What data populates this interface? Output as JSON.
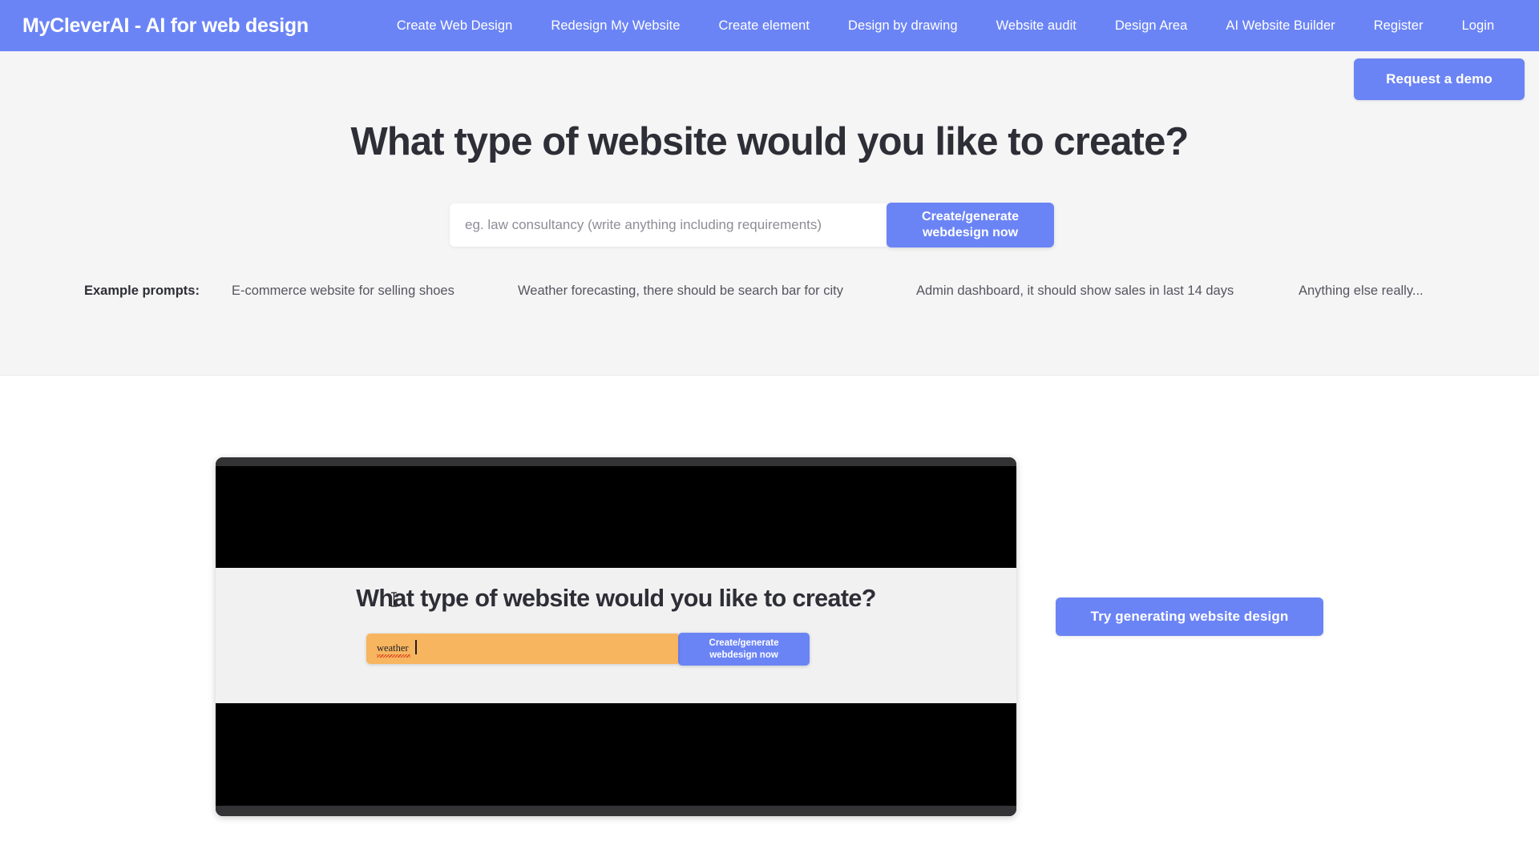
{
  "navbar": {
    "logo": "MyCleverAI - AI for web design",
    "links": [
      {
        "label": "Create Web Design"
      },
      {
        "label": "Redesign My Website"
      },
      {
        "label": "Create element"
      },
      {
        "label": "Design by drawing"
      },
      {
        "label": "Website audit"
      },
      {
        "label": "Design Area"
      },
      {
        "label": "AI Website Builder"
      },
      {
        "label": "Register"
      },
      {
        "label": "Login"
      }
    ],
    "background_color": "#6b84f5",
    "text_color": "#ffffff"
  },
  "hero": {
    "demo_button": "Request a demo",
    "title": "What type of website would you like to create?",
    "search": {
      "placeholder": "eg. law consultancy (write anything including requirements)",
      "value": ""
    },
    "generate_button_line1": "Create/generate",
    "generate_button_line2": "webdesign now",
    "prompts_label": "Example prompts:",
    "prompts": [
      {
        "label": "E-commerce website for selling shoes"
      },
      {
        "label": "Weather forecasting, there should be search bar for city"
      },
      {
        "label": "Admin dashboard, it should show sales in last 14 days"
      },
      {
        "label": "Anything else really..."
      }
    ],
    "background_color": "#f5f5f6",
    "accent_color": "#6b84f5"
  },
  "demo_section": {
    "player": {
      "inner_title": "What type of website would you like to create?",
      "inner_input_value": "weather",
      "inner_generate_line1": "Create/generate",
      "inner_generate_line2": "webdesign now",
      "input_highlight_color": "#f7b55f",
      "bezel_color": "#333336",
      "letterbox_color": "#000000"
    },
    "try_button": "Try generating website design"
  }
}
